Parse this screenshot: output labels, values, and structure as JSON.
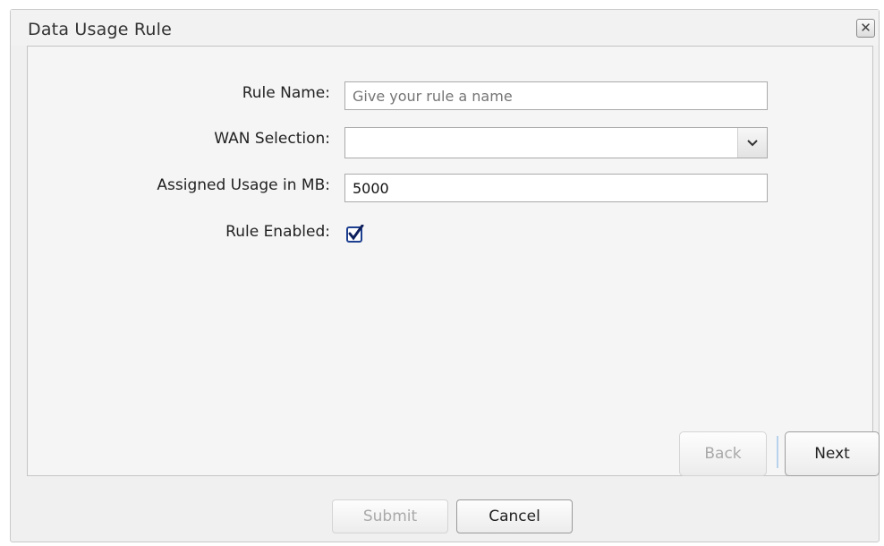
{
  "dialog": {
    "title": "Data Usage Rule",
    "close_icon": "close-icon"
  },
  "form": {
    "rule_name": {
      "label": "Rule Name:",
      "value": "",
      "placeholder": "Give your rule a name"
    },
    "wan_selection": {
      "label": "WAN Selection:",
      "selected": ""
    },
    "assigned_usage": {
      "label": "Assigned Usage in MB:",
      "value": "5000"
    },
    "rule_enabled": {
      "label": "Rule Enabled:",
      "checked": true
    }
  },
  "wizard": {
    "back_label": "Back",
    "next_label": "Next"
  },
  "footer": {
    "submit_label": "Submit",
    "cancel_label": "Cancel"
  },
  "colors": {
    "checkbox_border": "#1d3f8f",
    "checkbox_check": "#0e1f5c"
  }
}
